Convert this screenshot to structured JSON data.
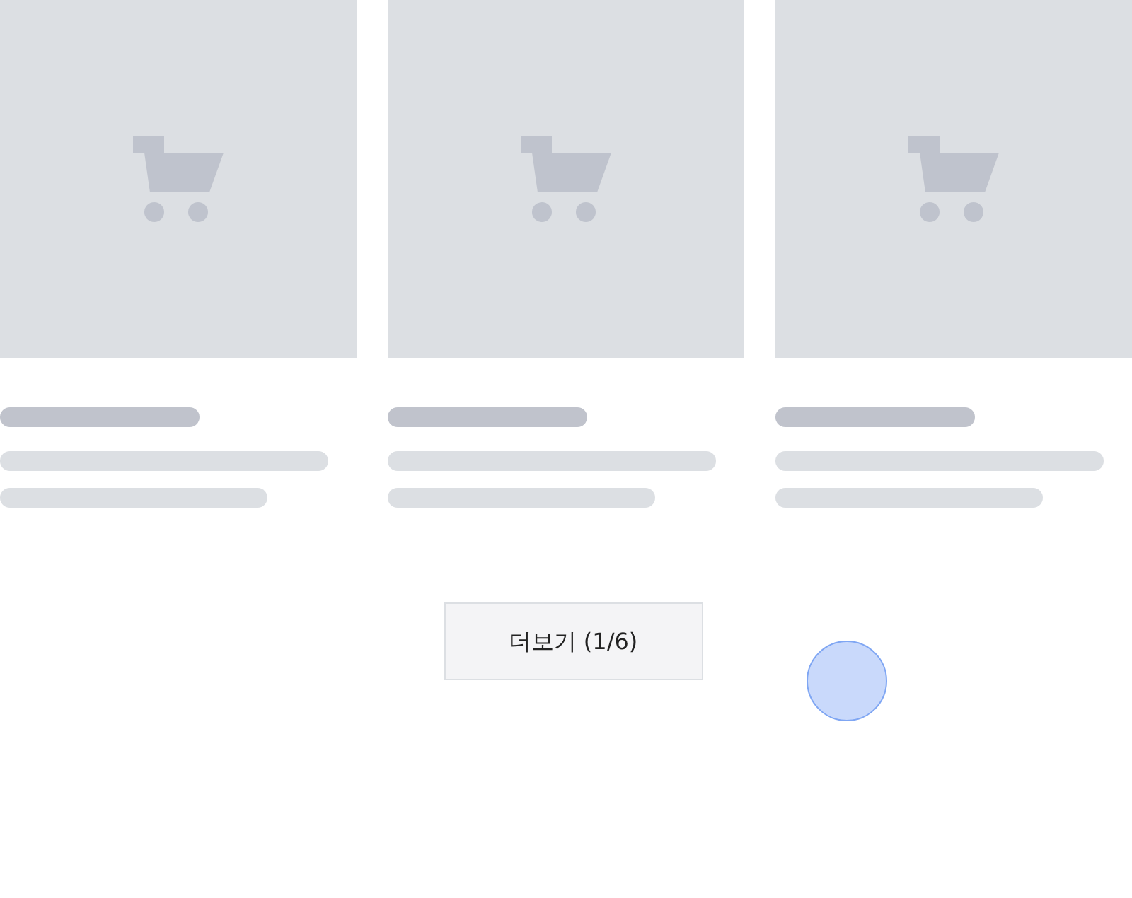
{
  "products": [
    {
      "loading": true
    },
    {
      "loading": true
    },
    {
      "loading": true
    }
  ],
  "more_button": {
    "label": "더보기 (1/6)"
  },
  "touch_indicator": {
    "visible": true
  }
}
